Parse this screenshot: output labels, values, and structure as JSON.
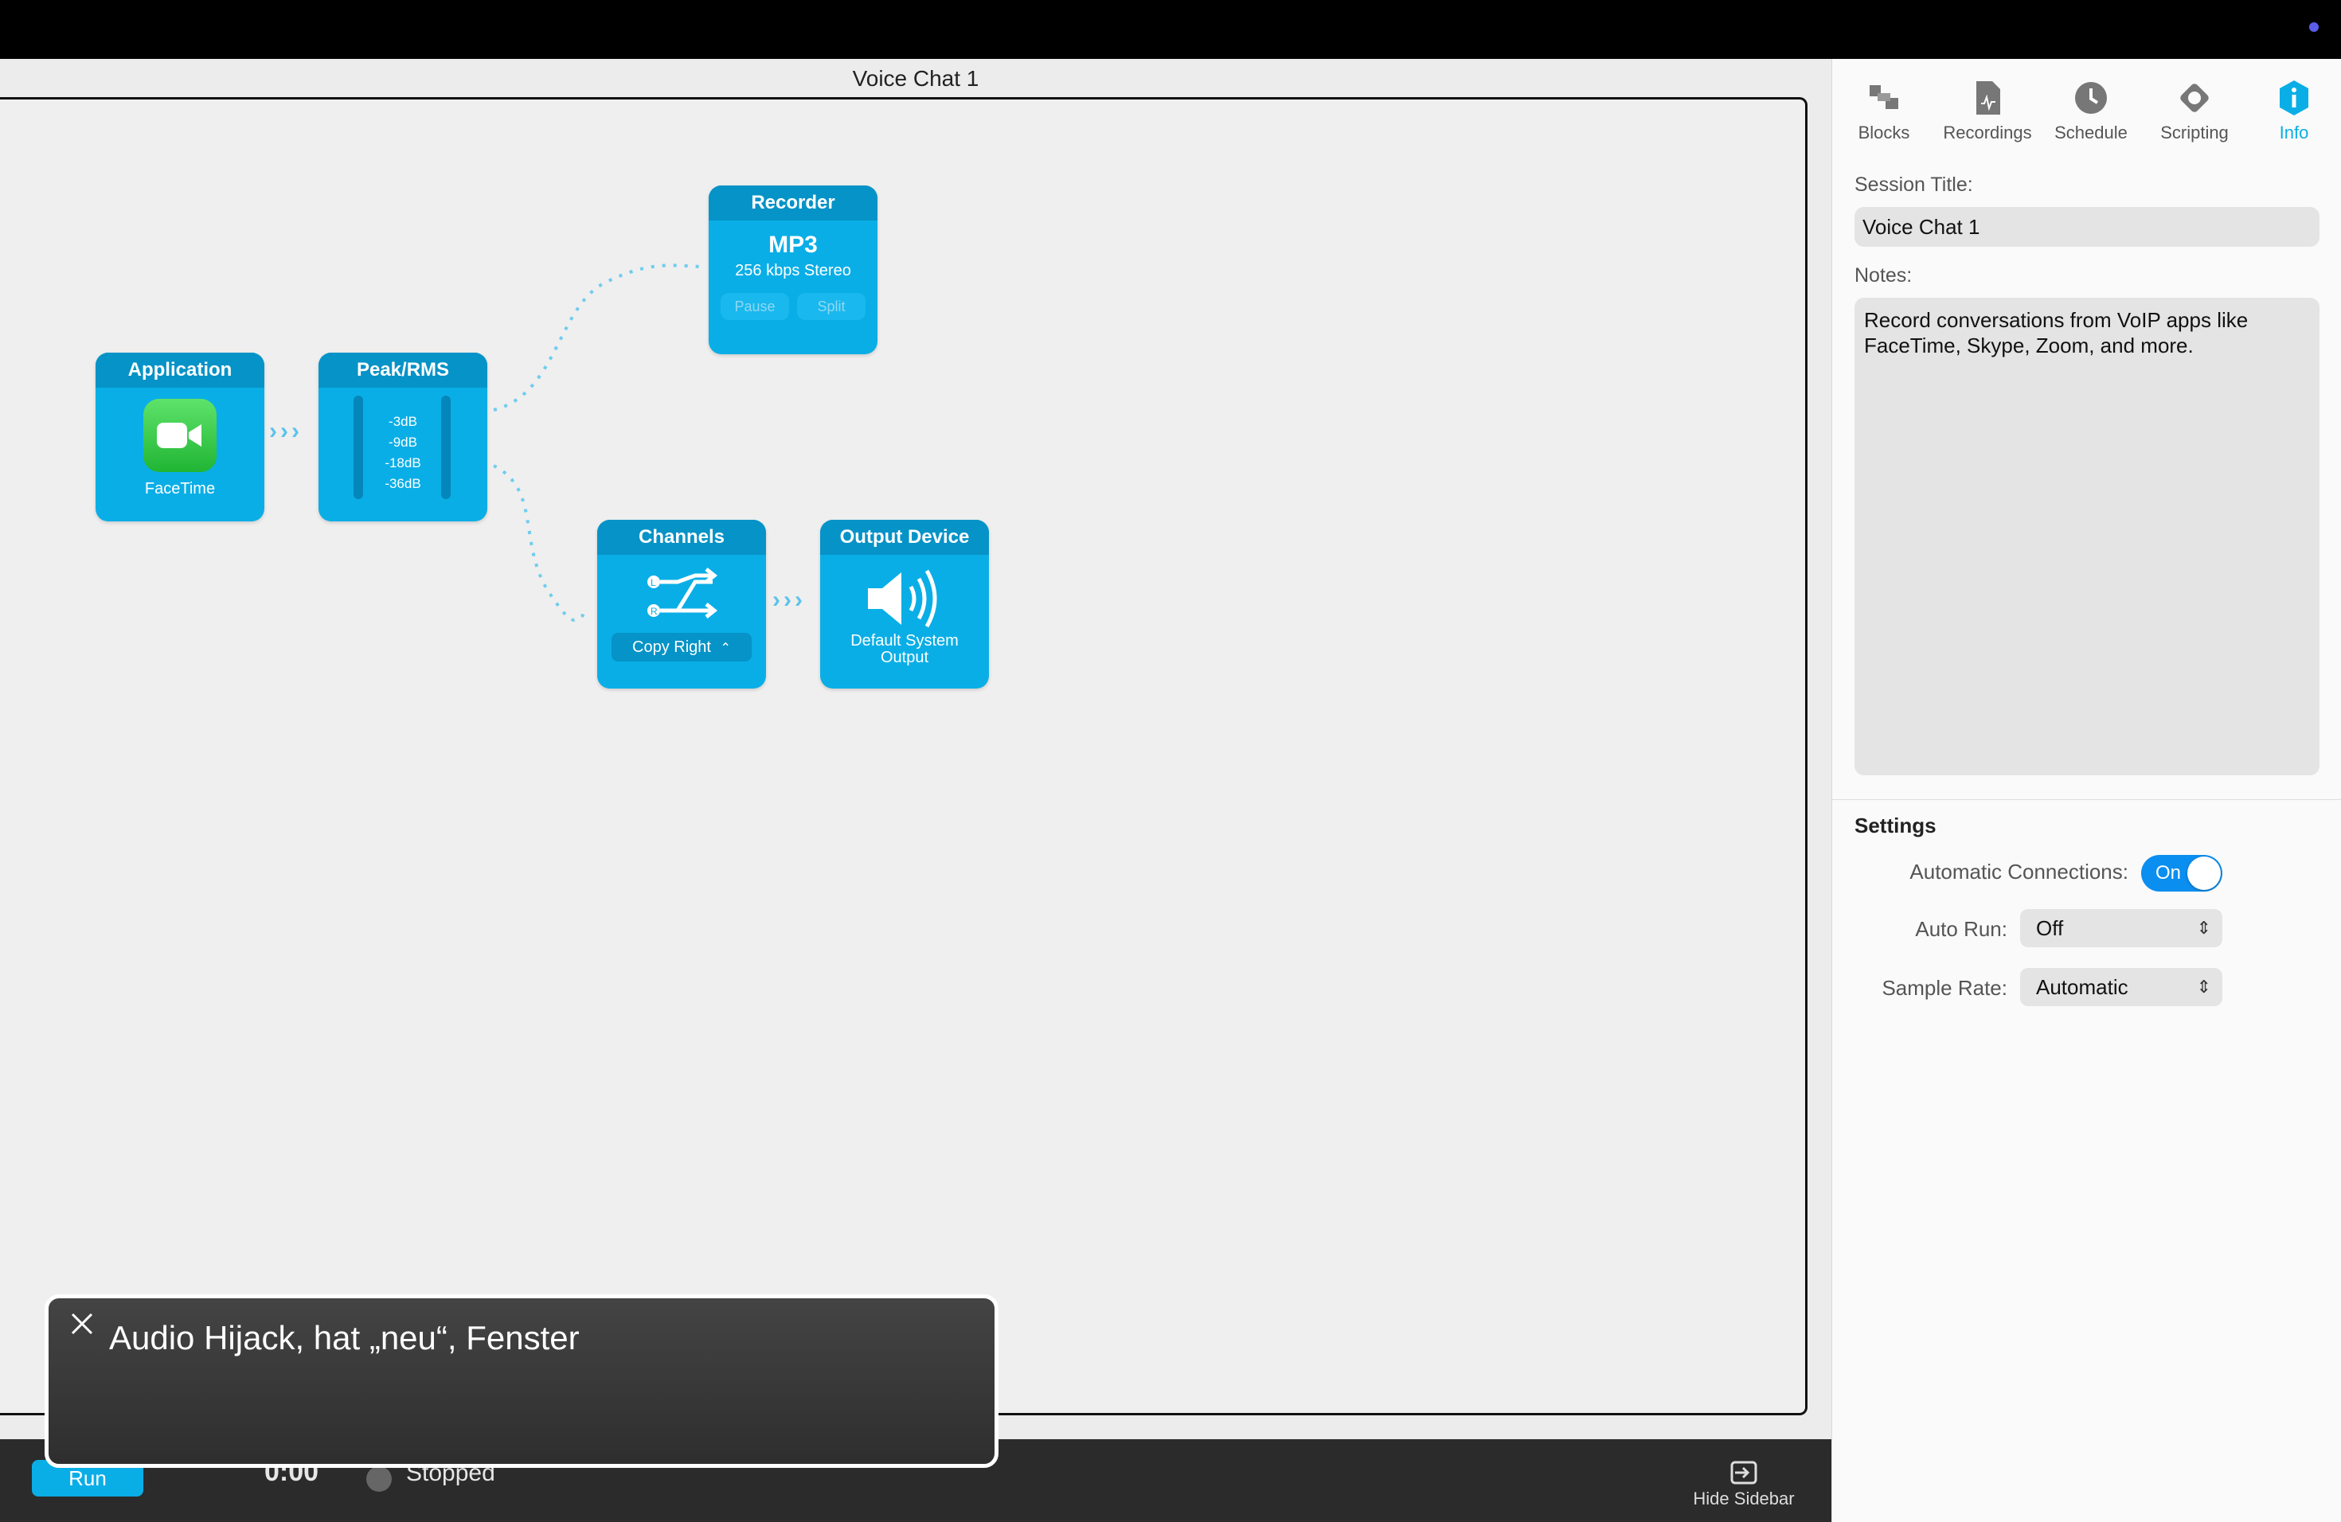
{
  "window": {
    "title": "Voice Chat 1"
  },
  "blocks": {
    "application": {
      "title": "Application",
      "app_name": "FaceTime"
    },
    "peak_rms": {
      "title": "Peak/RMS",
      "levels": [
        "-3dB",
        "-9dB",
        "-18dB",
        "-36dB"
      ]
    },
    "recorder": {
      "title": "Recorder",
      "format": "MP3",
      "quality": "256 kbps Stereo",
      "pause_label": "Pause",
      "split_label": "Split"
    },
    "channels": {
      "title": "Channels",
      "mode": "Copy Right"
    },
    "output": {
      "title": "Output Device",
      "device_line1": "Default System",
      "device_line2": "Output"
    }
  },
  "sidebar": {
    "tabs": [
      {
        "label": "Blocks",
        "icon": "blocks-icon"
      },
      {
        "label": "Recordings",
        "icon": "recordings-icon"
      },
      {
        "label": "Schedule",
        "icon": "clock-icon"
      },
      {
        "label": "Scripting",
        "icon": "scripting-icon"
      },
      {
        "label": "Info",
        "icon": "info-icon"
      }
    ],
    "active_tab": "Info",
    "session_title_label": "Session Title:",
    "session_title_value": "Voice Chat 1",
    "notes_label": "Notes:",
    "notes_value": "Record conversations from VoIP apps like FaceTime, Skype, Zoom, and more.",
    "settings_heading": "Settings",
    "automatic_connections_label": "Automatic Connections:",
    "automatic_connections_value": "On",
    "auto_run_label": "Auto Run:",
    "auto_run_value": "Off",
    "sample_rate_label": "Sample Rate:",
    "sample_rate_value": "Automatic"
  },
  "bottombar": {
    "run_label": "Run",
    "timer": "0:00",
    "status": "Stopped",
    "hide_sidebar_label": "Hide Sidebar"
  },
  "voiceover": {
    "caption": "Audio Hijack, hat „neu“, Fenster"
  },
  "colors": {
    "accent": "#0aaee6",
    "block_header": "#0693c7",
    "toggle": "#0a8ef0"
  }
}
